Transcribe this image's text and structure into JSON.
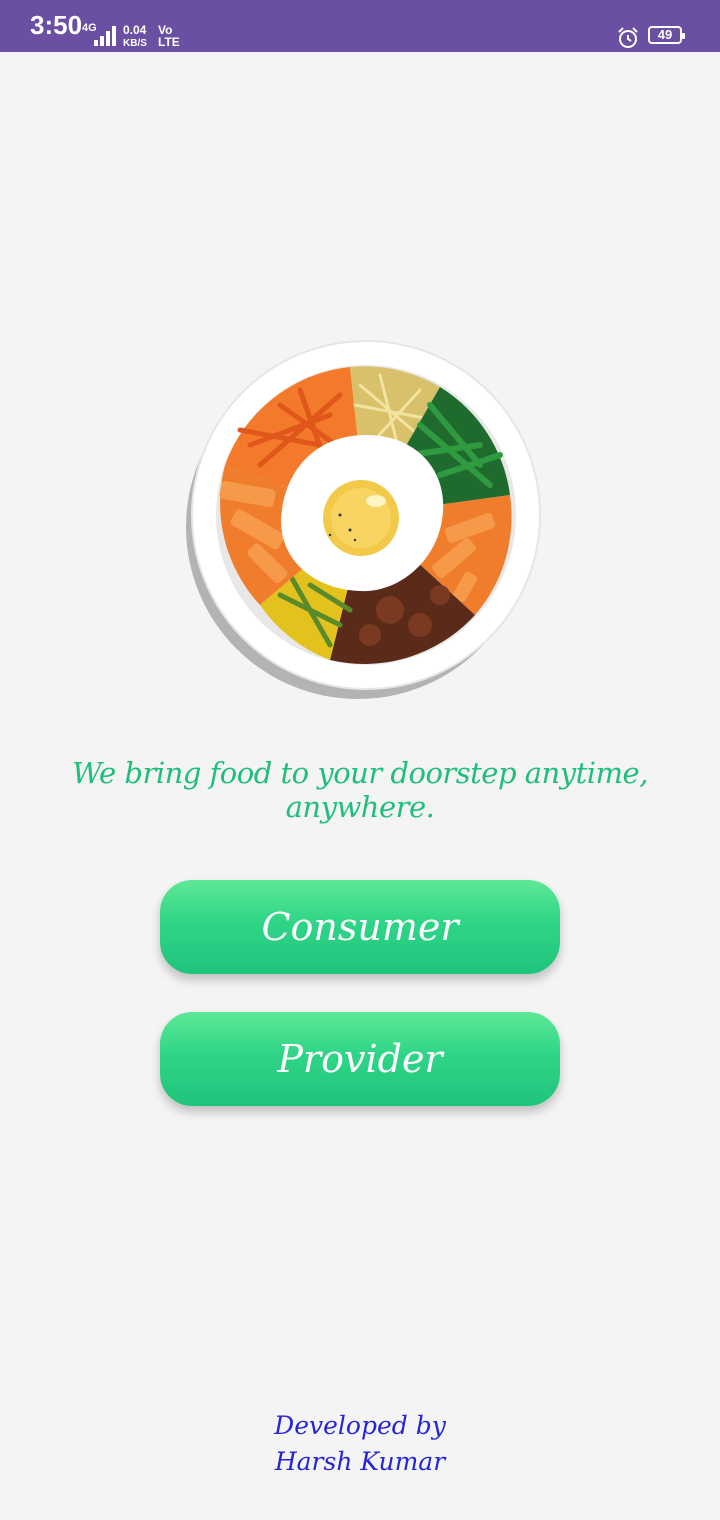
{
  "status_bar": {
    "time": "3:50",
    "network": "4G",
    "speed_value": "0.04",
    "speed_unit": "KB/S",
    "volte_top": "Vo",
    "volte_bottom": "LTE",
    "battery": "49",
    "color": "#6a4fa3"
  },
  "hero": {
    "icon": "bibimbap-bowl-illustration"
  },
  "tagline": "We bring food to your doorstep anytime, anywhere.",
  "buttons": {
    "consumer_label": "Consumer",
    "provider_label": "Provider",
    "color": "#2fd587"
  },
  "credits": {
    "line1": "Developed by",
    "line2": "Harsh Kumar"
  },
  "colors": {
    "background": "#f4f4f4",
    "tagline": "#1fbf7b",
    "credits": "#2525d6"
  }
}
